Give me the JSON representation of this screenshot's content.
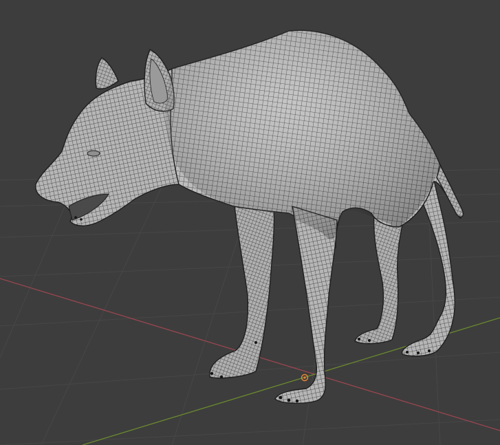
{
  "viewport": {
    "background": "#3d3d3d",
    "grid_color": "#4a4a4a",
    "x_axis_color": "#9a4650",
    "y_axis_color": "#6b8a2e",
    "mesh_fill": "#b9b9b9",
    "wire_color": "#2a2a2a",
    "origin_color": "#e8863a"
  },
  "object": {
    "kind": "hyena-mesh",
    "display": "wireframe-overlay"
  }
}
